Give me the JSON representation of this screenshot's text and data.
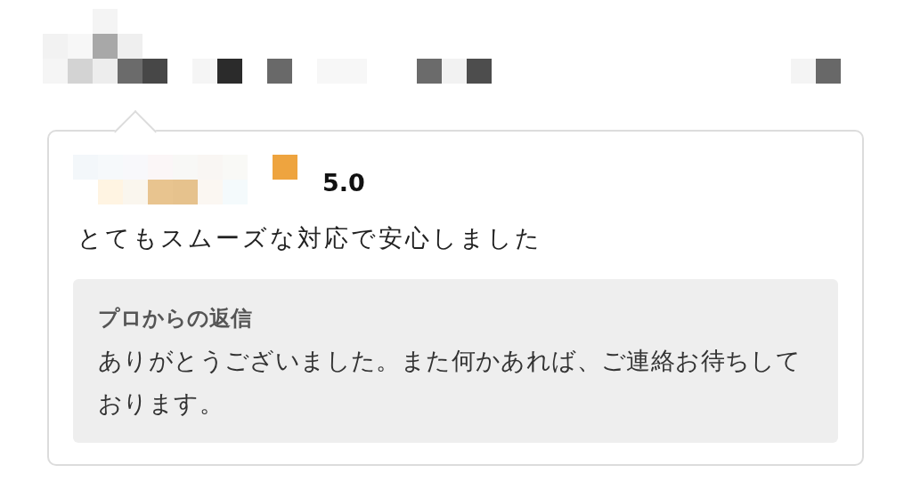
{
  "review": {
    "rating": "5.0",
    "text": "とてもスムーズな対応で安心しました"
  },
  "reply": {
    "title": "プロからの返信",
    "text": "ありがとうございました。また何かあれば、ご連絡お待ちしております。"
  }
}
